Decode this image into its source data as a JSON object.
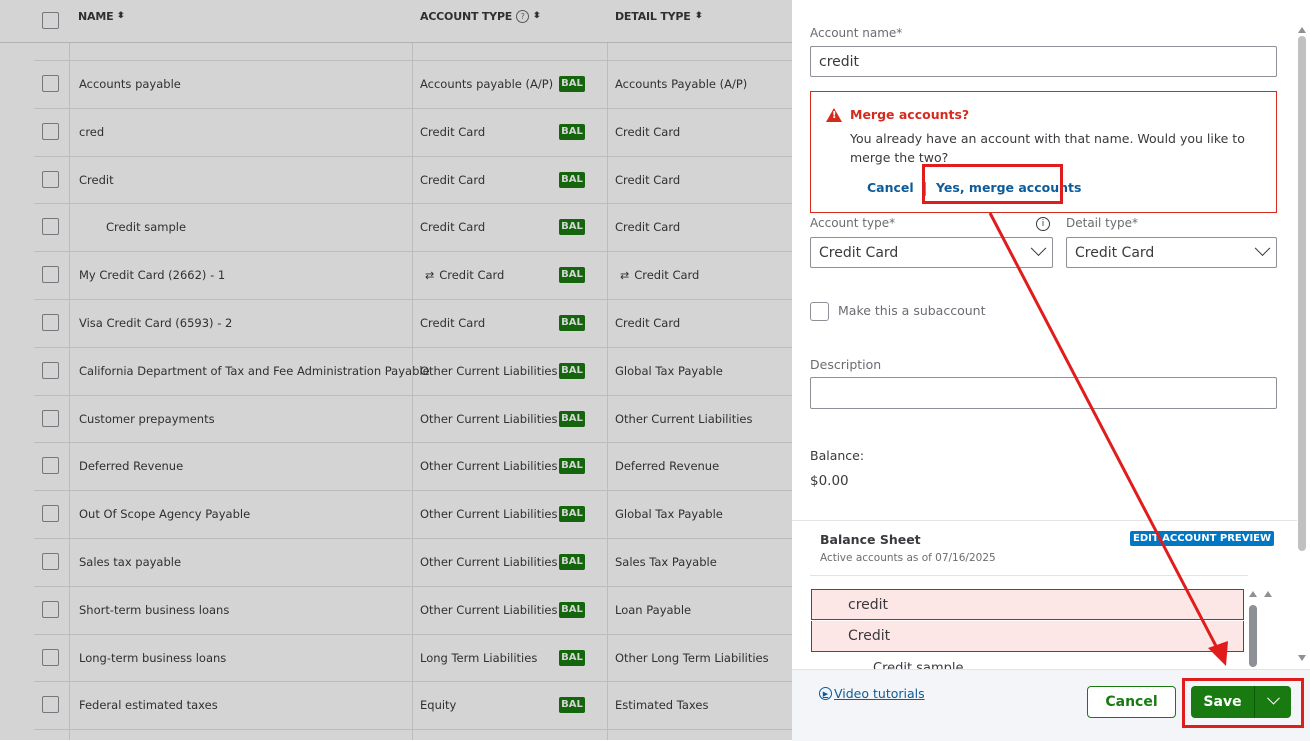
{
  "table": {
    "headers": {
      "name": "NAME",
      "account_type": "ACCOUNT TYPE",
      "detail_type": "DETAIL TYPE",
      "info_glyph": "?"
    },
    "bal_badge": "BAL",
    "rows": [
      {
        "name": "Accounts payable",
        "type": "Accounts payable (A/P)",
        "detail": "Accounts Payable (A/P)",
        "linked": false
      },
      {
        "name": "cred",
        "type": "Credit Card",
        "detail": "Credit Card",
        "linked": false
      },
      {
        "name": "Credit",
        "type": "Credit Card",
        "detail": "Credit Card",
        "linked": false
      },
      {
        "name": "Credit sample",
        "type": "Credit Card",
        "detail": "Credit Card",
        "linked": false
      },
      {
        "name": "My Credit Card (2662) - 1",
        "type": "Credit Card",
        "detail": "Credit Card",
        "linked": true
      },
      {
        "name": "Visa Credit Card (6593) - 2",
        "type": "Credit Card",
        "detail": "Credit Card",
        "linked": false
      },
      {
        "name": "California Department of Tax and Fee Administration Payable",
        "type": "Other Current Liabilities",
        "detail": "Global Tax Payable",
        "linked": false
      },
      {
        "name": "Customer prepayments",
        "type": "Other Current Liabilities",
        "detail": "Other Current Liabilities",
        "linked": false
      },
      {
        "name": "Deferred Revenue",
        "type": "Other Current Liabilities",
        "detail": "Deferred Revenue",
        "linked": false
      },
      {
        "name": "Out Of Scope Agency Payable",
        "type": "Other Current Liabilities",
        "detail": "Global Tax Payable",
        "linked": false
      },
      {
        "name": "Sales tax payable",
        "type": "Other Current Liabilities",
        "detail": "Sales Tax Payable",
        "linked": false
      },
      {
        "name": "Short-term business loans",
        "type": "Other Current Liabilities",
        "detail": "Loan Payable",
        "linked": false
      },
      {
        "name": "Long-term business loans",
        "type": "Long Term Liabilities",
        "detail": "Other Long Term Liabilities",
        "linked": false
      },
      {
        "name": "Federal estimated taxes",
        "type": "Equity",
        "detail": "Estimated Taxes",
        "linked": false
      }
    ]
  },
  "panel": {
    "account_name_label": "Account name*",
    "account_name_value": "credit",
    "merge": {
      "icon_glyph": "!",
      "title": "Merge accounts?",
      "message": "You already have an account with that name. Would you like to merge the two?",
      "cancel": "Cancel",
      "confirm": "Yes, merge accounts"
    },
    "account_type_label": "Account type*",
    "account_type_value": "Credit Card",
    "detail_type_label": "Detail type*",
    "detail_type_value": "Credit Card",
    "info_glyph": "i",
    "subaccount_label": "Make this a subaccount",
    "description_label": "Description",
    "description_value": "",
    "balance_label": "Balance:",
    "balance_value": "$0.00",
    "preview": {
      "title": "Balance Sheet",
      "subtitle": "Active accounts as of 07/16/2025",
      "edit_button": "EDIT ACCOUNT PREVIEW",
      "rows": [
        "credit",
        "Credit"
      ],
      "partial_row": "Credit sample"
    },
    "footer": {
      "video_link": "Video tutorials",
      "cancel": "Cancel",
      "save": "Save"
    }
  },
  "colors": {
    "accent_green": "#1a7a12",
    "error_red": "#d52b1e",
    "annotation_red": "#e01c1c",
    "link_blue": "#0d5c99"
  }
}
